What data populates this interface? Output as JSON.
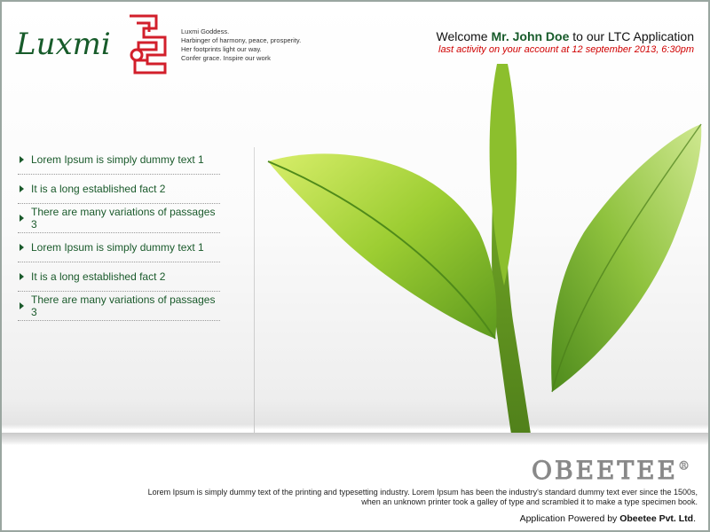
{
  "header": {
    "logo_text": "Luxmi",
    "tagline": [
      "Luxmi Goddess.",
      "Harbinger of harmony, peace, prosperity.",
      "Her footprints light our way.",
      "Confer grace. Inspire our work"
    ],
    "welcome_prefix": "Welcome",
    "user_name": "Mr. John Doe",
    "welcome_suffix": "to our LTC Application",
    "last_activity": "last activity on your account at 12 september 2013, 6:30pm"
  },
  "nav": {
    "items": [
      {
        "label": "Lorem Ipsum is simply dummy text 1"
      },
      {
        "label": "It is a long established fact 2"
      },
      {
        "label": "There are many variations of passages 3"
      },
      {
        "label": "Lorem Ipsum is simply dummy text 1"
      },
      {
        "label": "It is a long established fact 2"
      },
      {
        "label": "There are many variations of passages 3"
      }
    ]
  },
  "footer": {
    "brand": "OBEETEE",
    "brand_mark": "®",
    "text_line1": "Lorem Ipsum is simply dummy text of the printing and typesetting industry. Lorem Ipsum has been the industry's standard dummy text ever since the 1500s,",
    "text_line2": "when an unknown printer took a galley of type and scrambled it to make a type specimen book.",
    "powered_prefix": "Application Powered by",
    "powered_company": "Obeetee Pvt. Ltd",
    "powered_suffix": "."
  },
  "colors": {
    "brand_green": "#175b2a",
    "logo_red": "#d21f2b",
    "alert_red": "#d00000",
    "leaf_green": "#8cc63f"
  }
}
